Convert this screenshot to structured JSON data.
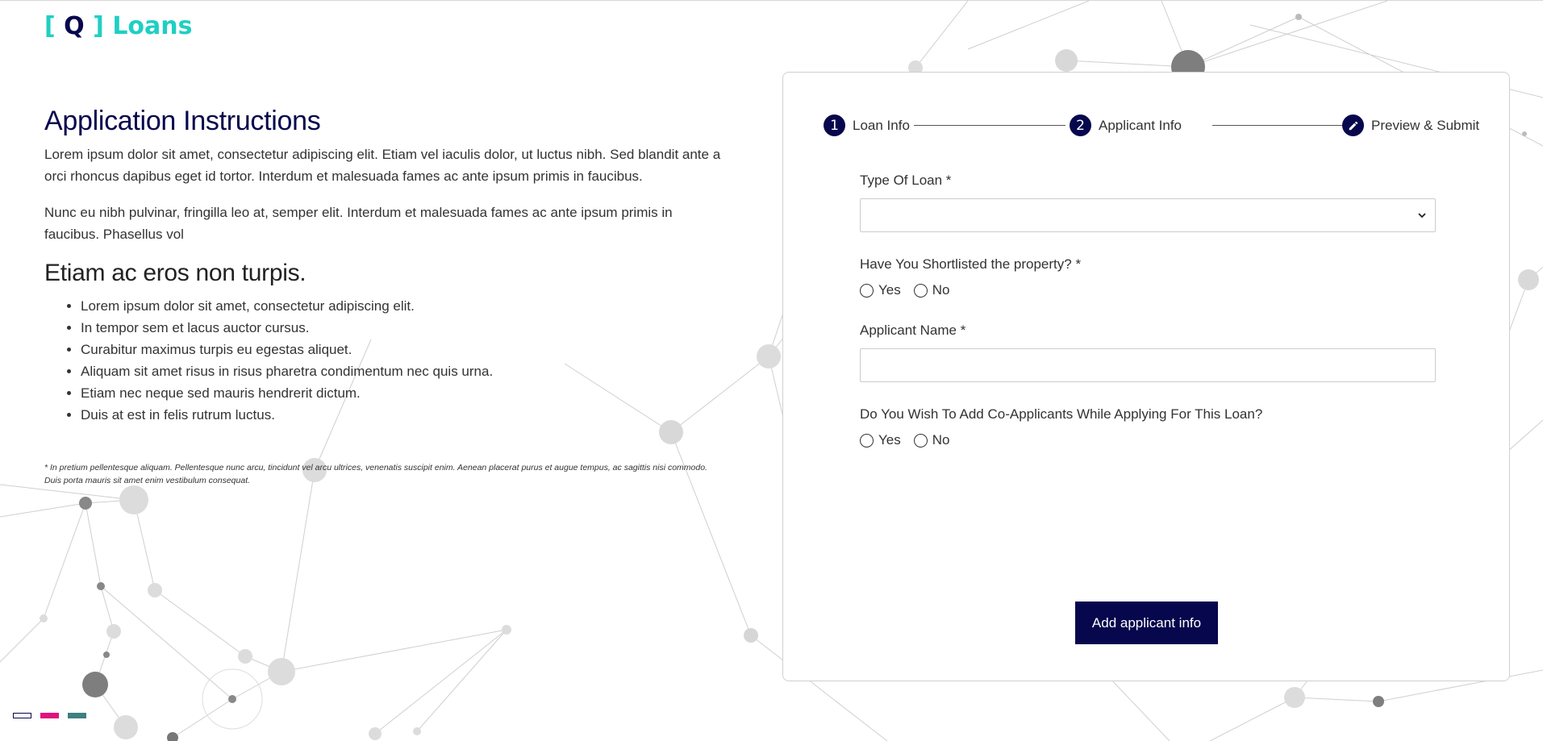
{
  "logo": {
    "bracket_open": "[",
    "letter": "Q",
    "bracket_close": "]",
    "word": "Loans"
  },
  "instructions": {
    "title": "Application Instructions",
    "para1": "Lorem ipsum dolor sit amet, consectetur adipiscing elit. Etiam vel iaculis dolor, ut luctus nibh. Sed blandit ante a orci rhoncus dapibus eget id tortor. Interdum et malesuada fames ac ante ipsum primis in faucibus.",
    "para2": "Nunc eu nibh pulvinar, fringilla leo at, semper elit. Interdum et malesuada fames ac ante ipsum primis in faucibus. Phasellus vol",
    "subtitle": "Etiam ac eros non turpis.",
    "bullets": [
      "Lorem ipsum dolor sit amet, consectetur adipiscing elit.",
      "In tempor sem et lacus auctor cursus.",
      "Curabitur maximus turpis eu egestas aliquet.",
      "Aliquam sit amet risus in risus pharetra condimentum nec quis urna.",
      "Etiam nec neque sed mauris hendrerit dictum.",
      "Duis at est in felis rutrum luctus."
    ],
    "footnote": "* In pretium pellentesque aliquam. Pellentesque nunc arcu, tincidunt vel arcu ultrices, venenatis suscipit enim. Aenean placerat purus et augue tempus, ac sagittis nisi commodo. Duis porta mauris sit amet enim vestibulum consequat."
  },
  "stepper": {
    "steps": [
      {
        "number": "1",
        "label": "Loan Info"
      },
      {
        "number": "2",
        "label": "Applicant Info"
      },
      {
        "icon": "pencil-icon",
        "label": "Preview & Submit"
      }
    ]
  },
  "form": {
    "loan_type_label": "Type Of Loan *",
    "loan_type_value": "",
    "shortlisted_label": "Have You Shortlisted the property? *",
    "applicant_name_label": "Applicant Name *",
    "applicant_name_value": "",
    "co_applicants_label": "Do You Wish To Add Co-Applicants While Applying For This Loan?",
    "yes": "Yes",
    "no": "No",
    "submit_label": "Add applicant info"
  },
  "colors": {
    "primary": "#07074d",
    "accent": "#1fcfc3",
    "swatch1": "#07074d",
    "swatch2": "#e0127e",
    "swatch3": "#3e7f80"
  }
}
